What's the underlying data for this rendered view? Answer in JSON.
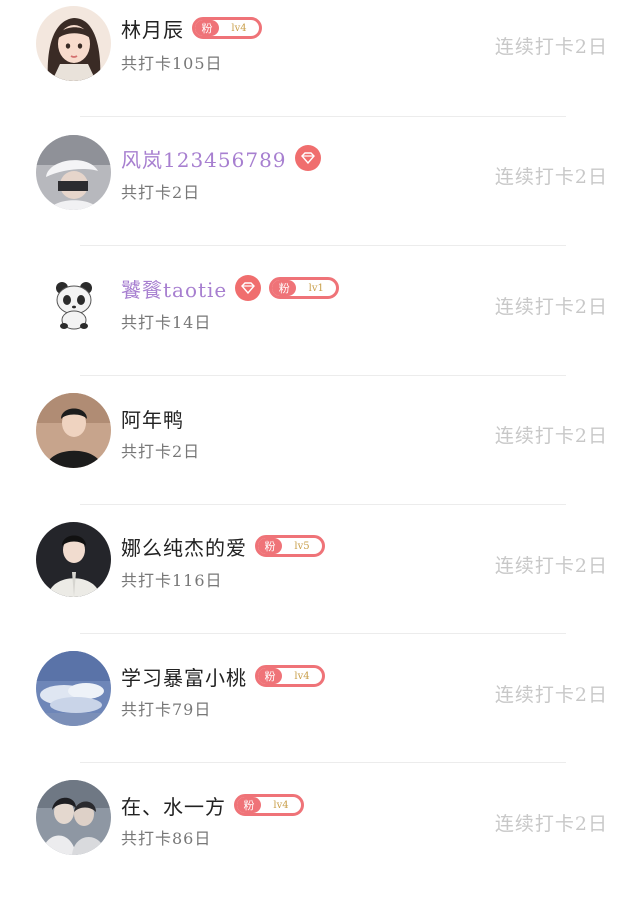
{
  "list": {
    "items": [
      {
        "name": "林月辰",
        "name_style": "normal",
        "gem": false,
        "fan": {
          "label": "粉",
          "level": "lv4"
        },
        "total": "共打卡105日",
        "streak": "连续打卡2日",
        "avatar": "avatar-illustrated-girl"
      },
      {
        "name": "风岚123456789",
        "name_style": "vip",
        "gem": true,
        "fan": null,
        "total": "共打卡2日",
        "streak": "连续打卡2日",
        "avatar": "avatar-person-cap"
      },
      {
        "name": "饕餮taotie",
        "name_style": "vip",
        "gem": true,
        "fan": {
          "label": "粉",
          "level": "lv1"
        },
        "total": "共打卡14日",
        "streak": "连续打卡2日",
        "avatar": "avatar-panda"
      },
      {
        "name": "阿年鸭",
        "name_style": "normal",
        "gem": false,
        "fan": null,
        "total": "共打卡2日",
        "streak": "连续打卡2日",
        "avatar": "avatar-young-man"
      },
      {
        "name": "娜么纯杰的爱",
        "name_style": "normal",
        "gem": false,
        "fan": {
          "label": "粉",
          "level": "lv5"
        },
        "total": "共打卡116日",
        "streak": "连续打卡2日",
        "avatar": "avatar-man-white-shirt"
      },
      {
        "name": "学习暴富小桃",
        "name_style": "normal",
        "gem": false,
        "fan": {
          "label": "粉",
          "level": "lv4"
        },
        "total": "共打卡79日",
        "streak": "连续打卡2日",
        "avatar": "avatar-sky-clouds"
      },
      {
        "name": "在、水一方",
        "name_style": "normal",
        "gem": false,
        "fan": {
          "label": "粉",
          "level": "lv4"
        },
        "total": "共打卡86日",
        "streak": "连续打卡2日",
        "avatar": "avatar-couple"
      }
    ]
  },
  "colors": {
    "accent": "#ef7378",
    "vip_name": "#a77fd0",
    "streak_text": "#c8c8c8",
    "sub_text": "#777777"
  }
}
